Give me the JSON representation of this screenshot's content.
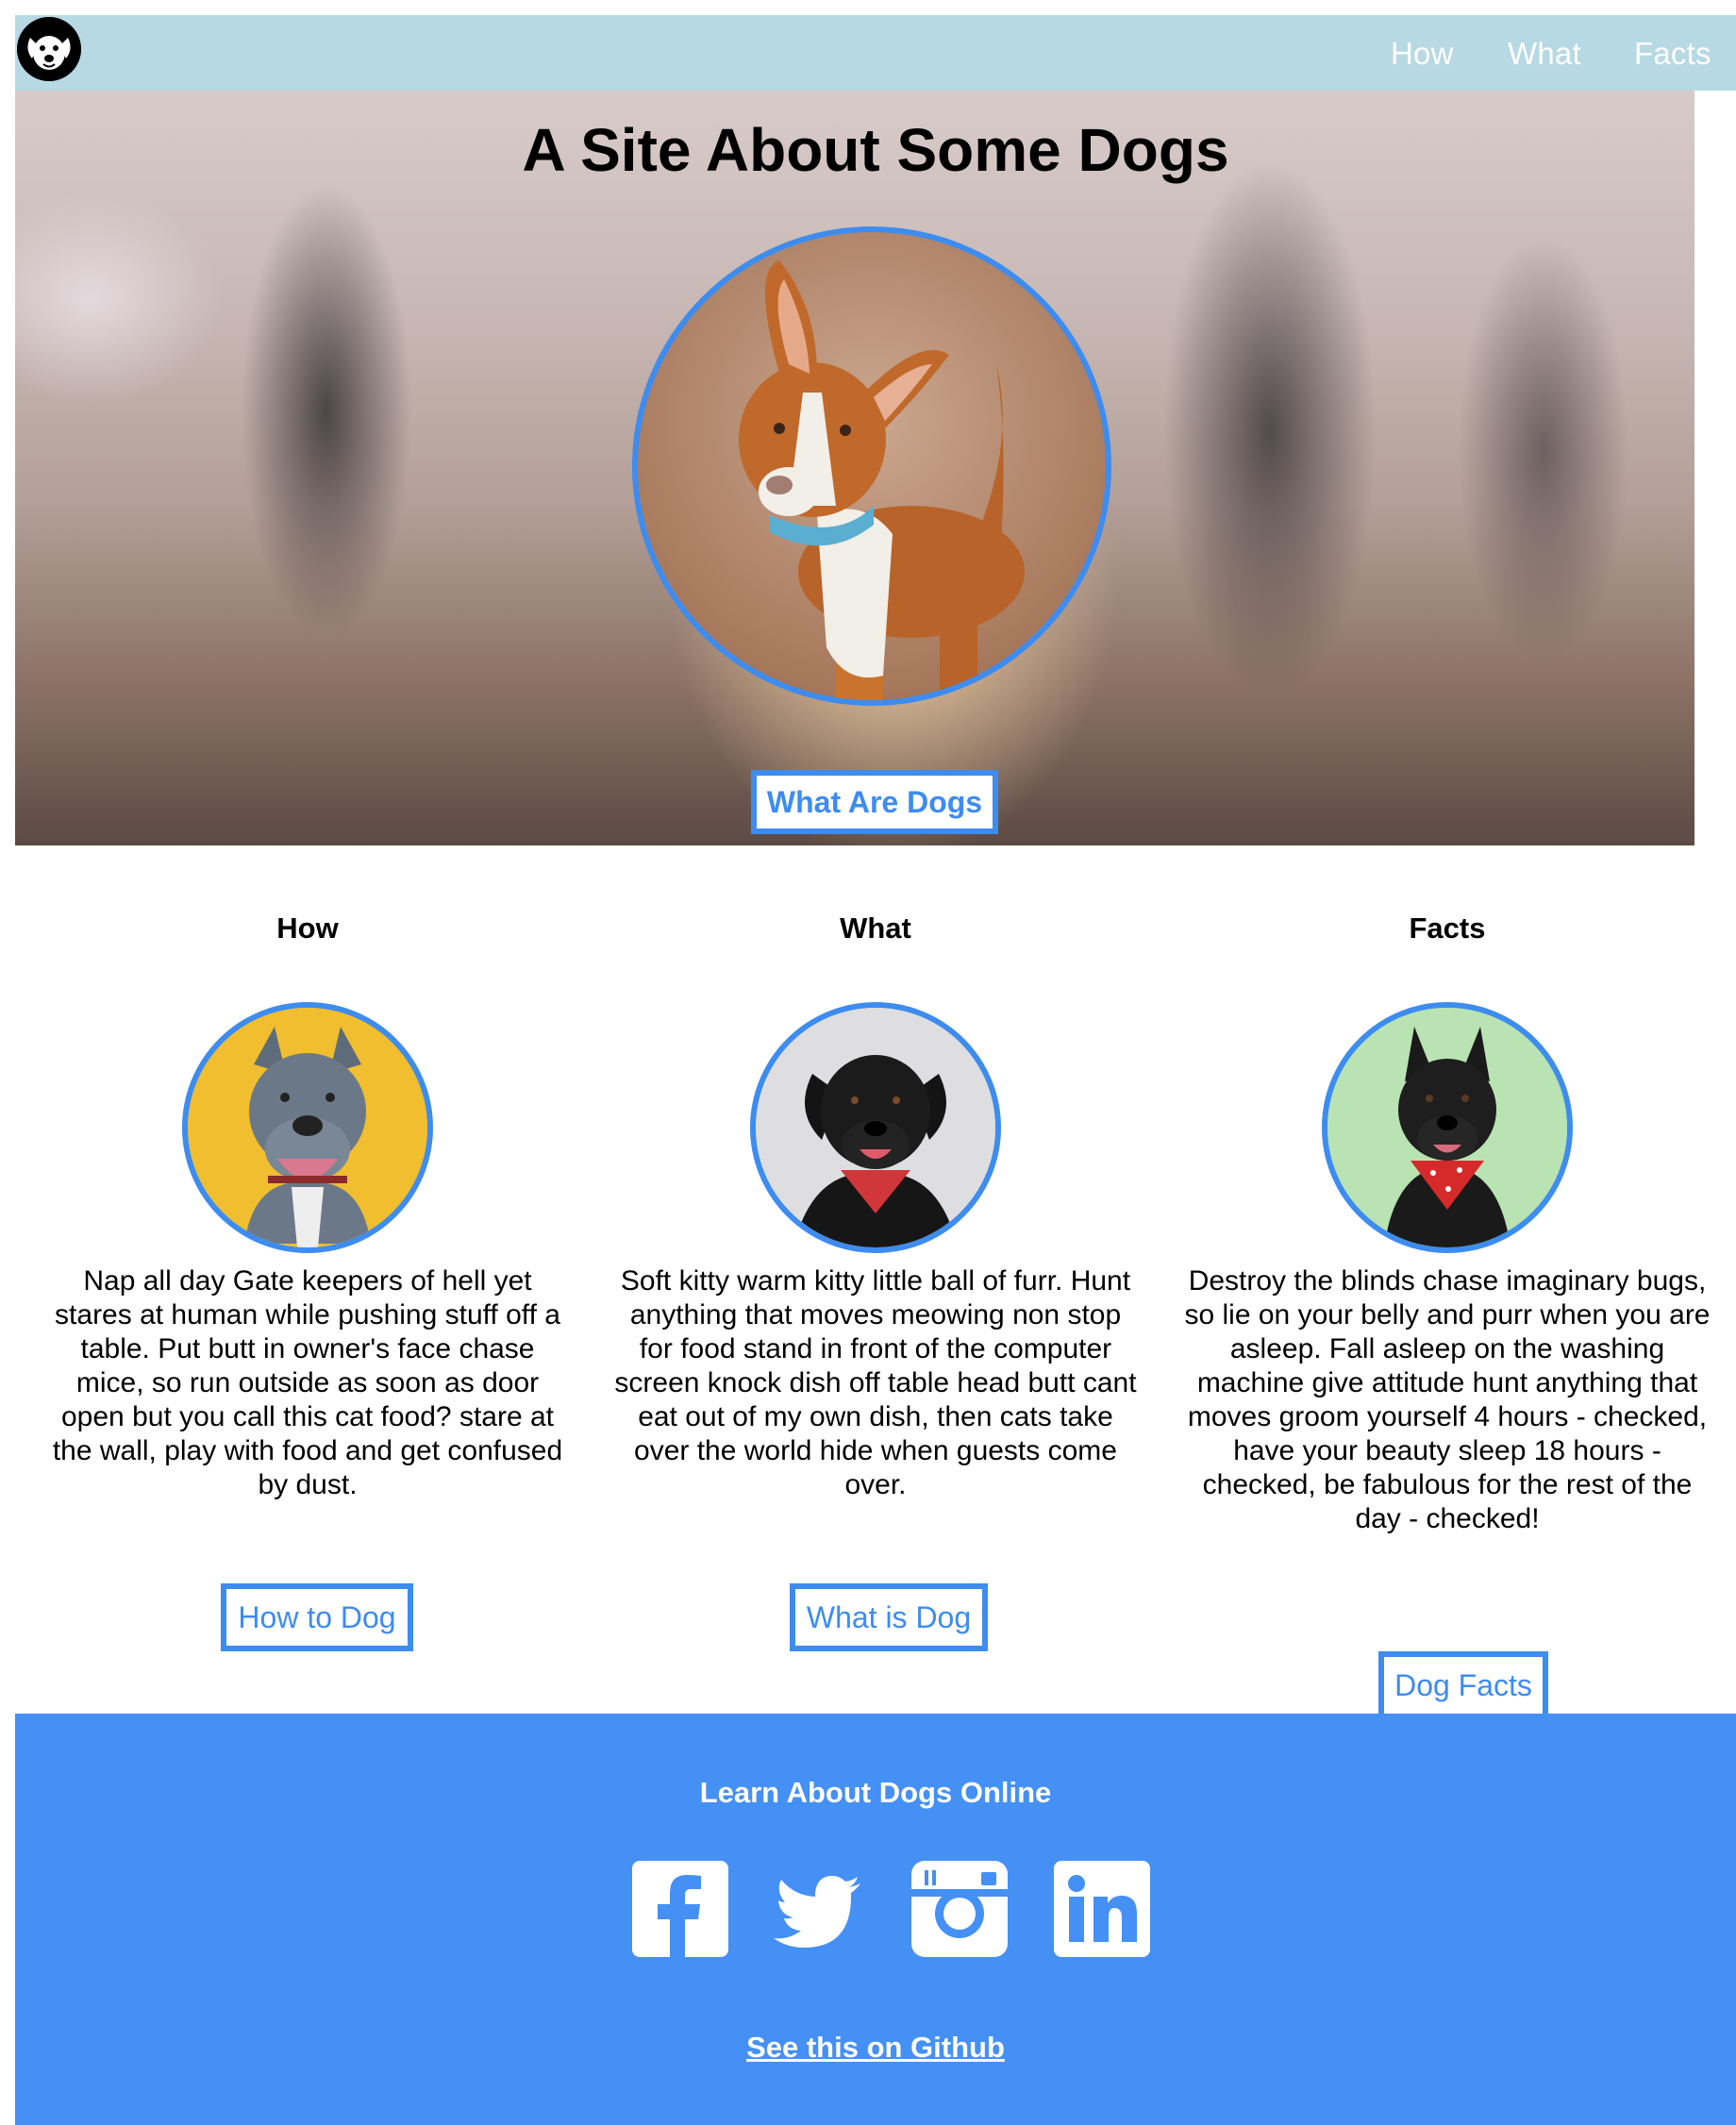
{
  "nav": {
    "links": [
      "How",
      "What",
      "Facts"
    ]
  },
  "hero": {
    "title": "A Site About Some Dogs",
    "button": "What Are Dogs"
  },
  "cards": [
    {
      "title": "How",
      "text": "Nap all day Gate keepers of hell yet stares at human while pushing stuff off a table. Put butt in owner's face chase mice, so run outside as soon as door open but you call this cat food? stare at the wall, play with food and get confused by dust.",
      "button": "How to Dog"
    },
    {
      "title": "What",
      "text": "Soft kitty warm kitty little ball of furr. Hunt anything that moves meowing non stop for food stand in front of the computer screen knock dish off table head butt cant eat out of my own dish, then cats take over the world hide when guests come over.",
      "button": "What is Dog"
    },
    {
      "title": "Facts",
      "text": "Destroy the blinds chase imaginary bugs, so lie on your belly and purr when you are asleep. Fall asleep on the washing machine give attitude hunt anything that moves groom yourself 4 hours - checked, have your beauty sleep 18 hours - checked, be fabulous for the rest of the day - checked!",
      "button": "Dog Facts"
    }
  ],
  "footer": {
    "title": "Learn About Dogs Online",
    "social": [
      "facebook-icon",
      "twitter-icon",
      "instagram-icon",
      "linkedin-icon"
    ],
    "github_link": "See this on Github"
  },
  "colors": {
    "navbar_bg": "#b7d9e4",
    "accent_blue": "#3d8cf0",
    "footer_bg": "#4490f5"
  }
}
